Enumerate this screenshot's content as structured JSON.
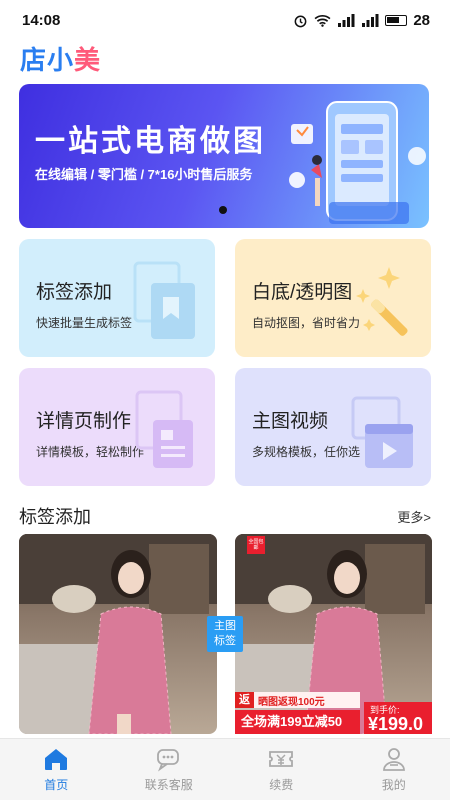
{
  "status_bar": {
    "time": "14:08",
    "battery": "28"
  },
  "logo": {
    "part1": "店小",
    "part2": "美"
  },
  "banner": {
    "title": "一站式电商做图",
    "subtitle": "在线编辑 / 零门槛 / 7*16小时售后服务"
  },
  "features": [
    {
      "title": "标签添加",
      "desc": "快速批量生成标签"
    },
    {
      "title": "白底/透明图",
      "desc": "自动抠图，省时省力"
    },
    {
      "title": "详情页制作",
      "desc": "详情模板，轻松制作"
    },
    {
      "title": "主图视频",
      "desc": "多规格模板，任你选"
    }
  ],
  "section": {
    "title": "标签添加",
    "more": "更多>"
  },
  "tiles": {
    "tag_line1": "主图",
    "tag_line2": "标签",
    "badge_new": "全国包邮",
    "promo_fan": "返",
    "promo_top": "晒图返现100元",
    "promo_bottom": "全场满199立减50",
    "price_label": "到手价:",
    "price_value": "¥199.0"
  },
  "bottom_nav": [
    {
      "label": "首页",
      "icon": "home-icon"
    },
    {
      "label": "联系客服",
      "icon": "chat-icon"
    },
    {
      "label": "续费",
      "icon": "ticket-yen-icon"
    },
    {
      "label": "我的",
      "icon": "user-icon"
    }
  ],
  "colors": {
    "accent": "#1f7ae0",
    "promo_red": "#e91f2e"
  }
}
